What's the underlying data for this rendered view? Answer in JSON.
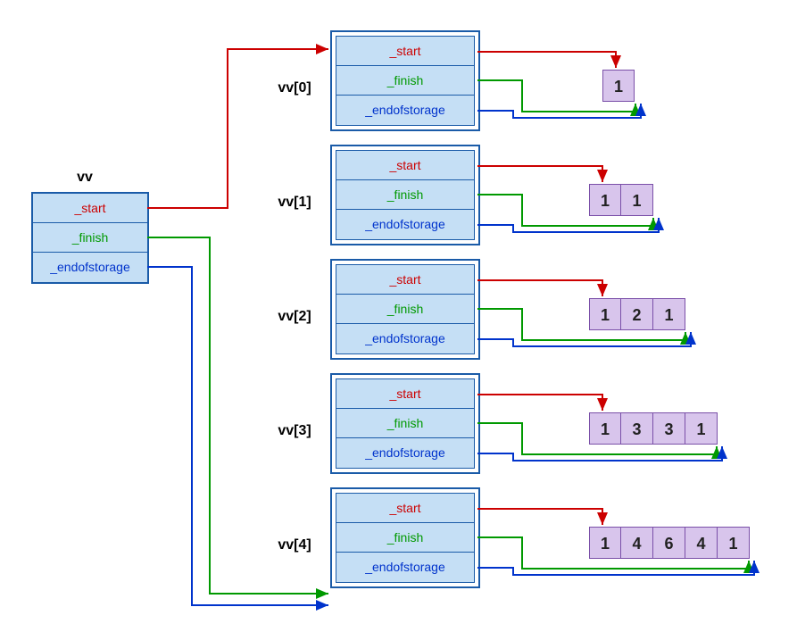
{
  "outer": {
    "label": "vv",
    "fields": {
      "start": "_start",
      "finish": "_finish",
      "endofstorage": "_endofstorage"
    }
  },
  "rows": [
    {
      "label": "vv[0]",
      "fields": {
        "start": "_start",
        "finish": "_finish",
        "endofstorage": "_endofstorage"
      },
      "data": [
        "1"
      ]
    },
    {
      "label": "vv[1]",
      "fields": {
        "start": "_start",
        "finish": "_finish",
        "endofstorage": "_endofstorage"
      },
      "data": [
        "1",
        "1"
      ]
    },
    {
      "label": "vv[2]",
      "fields": {
        "start": "_start",
        "finish": "_finish",
        "endofstorage": "_endofstorage"
      },
      "data": [
        "1",
        "2",
        "1"
      ]
    },
    {
      "label": "vv[3]",
      "fields": {
        "start": "_start",
        "finish": "_finish",
        "endofstorage": "_endofstorage"
      },
      "data": [
        "1",
        "3",
        "3",
        "1"
      ]
    },
    {
      "label": "vv[4]",
      "fields": {
        "start": "_start",
        "finish": "_finish",
        "endofstorage": "_endofstorage"
      },
      "data": [
        "1",
        "4",
        "6",
        "4",
        "1"
      ]
    }
  ]
}
